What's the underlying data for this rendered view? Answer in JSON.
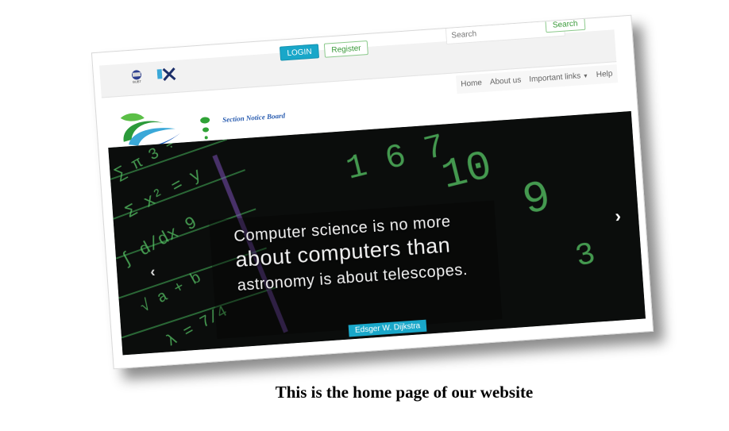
{
  "header": {
    "logos": [
      "bubt-logo",
      "x-logo"
    ],
    "bubt_label": "BUBT",
    "login_label": "LOGIN",
    "register_label": "Register",
    "search_placeholder": "Search",
    "search_button_label": "Search"
  },
  "nav": {
    "items": [
      "Home",
      "About us",
      "Important links",
      "Help"
    ]
  },
  "brand": {
    "tagline": "Section Notice Board"
  },
  "hero": {
    "quote_line1": "Computer science is no more",
    "quote_line2": "about computers than",
    "quote_line3": "astronomy is about telescopes.",
    "author": "Edsger W. Dijkstra"
  },
  "caption": "This is the home page of our website",
  "colors": {
    "accent": "#19a7c9",
    "green": "#3a9a3a",
    "hero_bg": "#0b0d0c",
    "chalk": "#57c766"
  }
}
